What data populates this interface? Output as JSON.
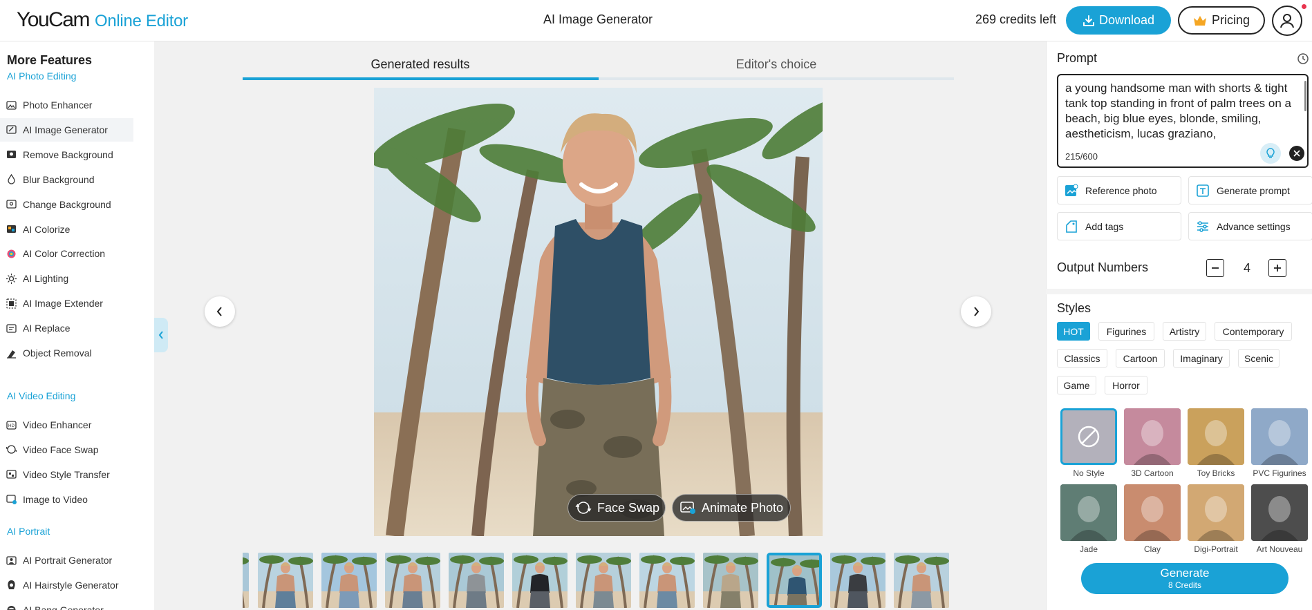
{
  "header": {
    "logo_main": "YouCam",
    "logo_sub": "Online Editor",
    "title": "AI Image Generator",
    "credits": "269 credits left",
    "download_label": "Download",
    "pricing_label": "Pricing"
  },
  "sidebar": {
    "title": "More Features",
    "sections": [
      {
        "label": "AI Photo Editing",
        "items": [
          {
            "label": "Photo Enhancer",
            "icon": "photo-enhancer-icon"
          },
          {
            "label": "AI Image Generator",
            "icon": "image-generator-icon",
            "active": true
          },
          {
            "label": "Remove Background",
            "icon": "remove-background-icon"
          },
          {
            "label": "Blur Background",
            "icon": "blur-background-icon"
          },
          {
            "label": "Change Background",
            "icon": "change-background-icon"
          },
          {
            "label": "AI Colorize",
            "icon": "colorize-icon"
          },
          {
            "label": "AI Color Correction",
            "icon": "color-correction-icon"
          },
          {
            "label": "AI Lighting",
            "icon": "lighting-icon"
          },
          {
            "label": "AI Image Extender",
            "icon": "image-extender-icon"
          },
          {
            "label": "AI Replace",
            "icon": "replace-icon"
          },
          {
            "label": "Object Removal",
            "icon": "object-removal-icon"
          }
        ]
      },
      {
        "label": "AI Video Editing",
        "items": [
          {
            "label": "Video Enhancer",
            "icon": "video-enhancer-icon"
          },
          {
            "label": "Video Face Swap",
            "icon": "video-face-swap-icon"
          },
          {
            "label": "Video Style Transfer",
            "icon": "video-style-transfer-icon"
          },
          {
            "label": "Image to Video",
            "icon": "image-to-video-icon"
          }
        ]
      },
      {
        "label": "AI Portrait",
        "items": [
          {
            "label": "AI Portrait Generator",
            "icon": "portrait-generator-icon"
          },
          {
            "label": "AI Hairstyle Generator",
            "icon": "hairstyle-icon"
          },
          {
            "label": "AI Bang Generator",
            "icon": "bang-icon"
          }
        ]
      }
    ]
  },
  "center": {
    "tabs": [
      {
        "label": "Generated results",
        "active": true
      },
      {
        "label": "Editor's choice",
        "active": false
      }
    ],
    "face_swap_label": "Face Swap",
    "animate_photo_label": "Animate Photo",
    "thumbnails": [
      {
        "shirt": "#6d7f8e",
        "shorts": "#8a8f76",
        "bg": "#a9c7d8"
      },
      {
        "shirt": "none",
        "shorts": "#5f7f9a",
        "bg": "#b9d3e0"
      },
      {
        "shirt": "none",
        "shorts": "#7d9bb8",
        "bg": "#a4c6de"
      },
      {
        "shirt": "none",
        "shorts": "#6a7f93",
        "bg": "#b5cfdc"
      },
      {
        "shirt": "#8e9397",
        "shorts": "#6e7b86",
        "bg": "#aac9d6"
      },
      {
        "shirt": "#222428",
        "shorts": "#5a5f66",
        "bg": "#b1cfd9"
      },
      {
        "shirt": "none",
        "shorts": "#7c8a92",
        "bg": "#b6d0db"
      },
      {
        "shirt": "none",
        "shorts": "#6c8aa3",
        "bg": "#bcd6e3"
      },
      {
        "shirt": "#b9a68a",
        "shorts": "#85806a",
        "bg": "#a7c3c9"
      },
      {
        "shirt": "#2f5572",
        "shorts": "#7a7360",
        "bg": "#9fc1c9",
        "selected": true
      },
      {
        "shirt": "#3a3d41",
        "shorts": "#4f565f",
        "bg": "#a9c9dc"
      },
      {
        "shirt": "none",
        "shorts": "#8c99a4",
        "bg": "#b8d1de"
      }
    ]
  },
  "right": {
    "prompt_label": "Prompt",
    "prompt_text": "a young handsome man with shorts & tight tank top standing in front of palm trees on a beach, big blue eyes, blonde, smiling, aestheticism, lucas graziano,",
    "prompt_count": "215/600",
    "actions": [
      {
        "label": "Reference photo",
        "icon": "reference-photo-icon"
      },
      {
        "label": "Generate prompt",
        "icon": "generate-prompt-icon"
      },
      {
        "label": "Add tags",
        "icon": "tag-icon"
      },
      {
        "label": "Advance settings",
        "icon": "sliders-icon"
      }
    ],
    "output_label": "Output Numbers",
    "output_value": "4",
    "styles_label": "Styles",
    "chips": [
      {
        "label": "HOT",
        "active": true
      },
      {
        "label": "Figurines"
      },
      {
        "label": "Artistry"
      },
      {
        "label": "Contemporary"
      },
      {
        "label": "Classics"
      },
      {
        "label": "Cartoon"
      },
      {
        "label": "Imaginary"
      },
      {
        "label": "Scenic"
      },
      {
        "label": "Game"
      },
      {
        "label": "Horror"
      }
    ],
    "styles": [
      {
        "name": "No Style",
        "color": "#b3b1bb",
        "selected": true
      },
      {
        "name": "3D Cartoon",
        "color": "#c58a9d"
      },
      {
        "name": "Toy Bricks",
        "color": "#caa15c"
      },
      {
        "name": "PVC Figurines",
        "color": "#8fa9c8"
      },
      {
        "name": "Jade",
        "color": "#5f7d74"
      },
      {
        "name": "Clay",
        "color": "#c98c6f"
      },
      {
        "name": "Digi-Portrait",
        "color": "#d2a873"
      },
      {
        "name": "Art Nouveau",
        "color": "#4d4d4d"
      }
    ],
    "generate_label": "Generate",
    "generate_credits": "8 Credits"
  },
  "colors": {
    "accent": "#1aa2d6"
  }
}
